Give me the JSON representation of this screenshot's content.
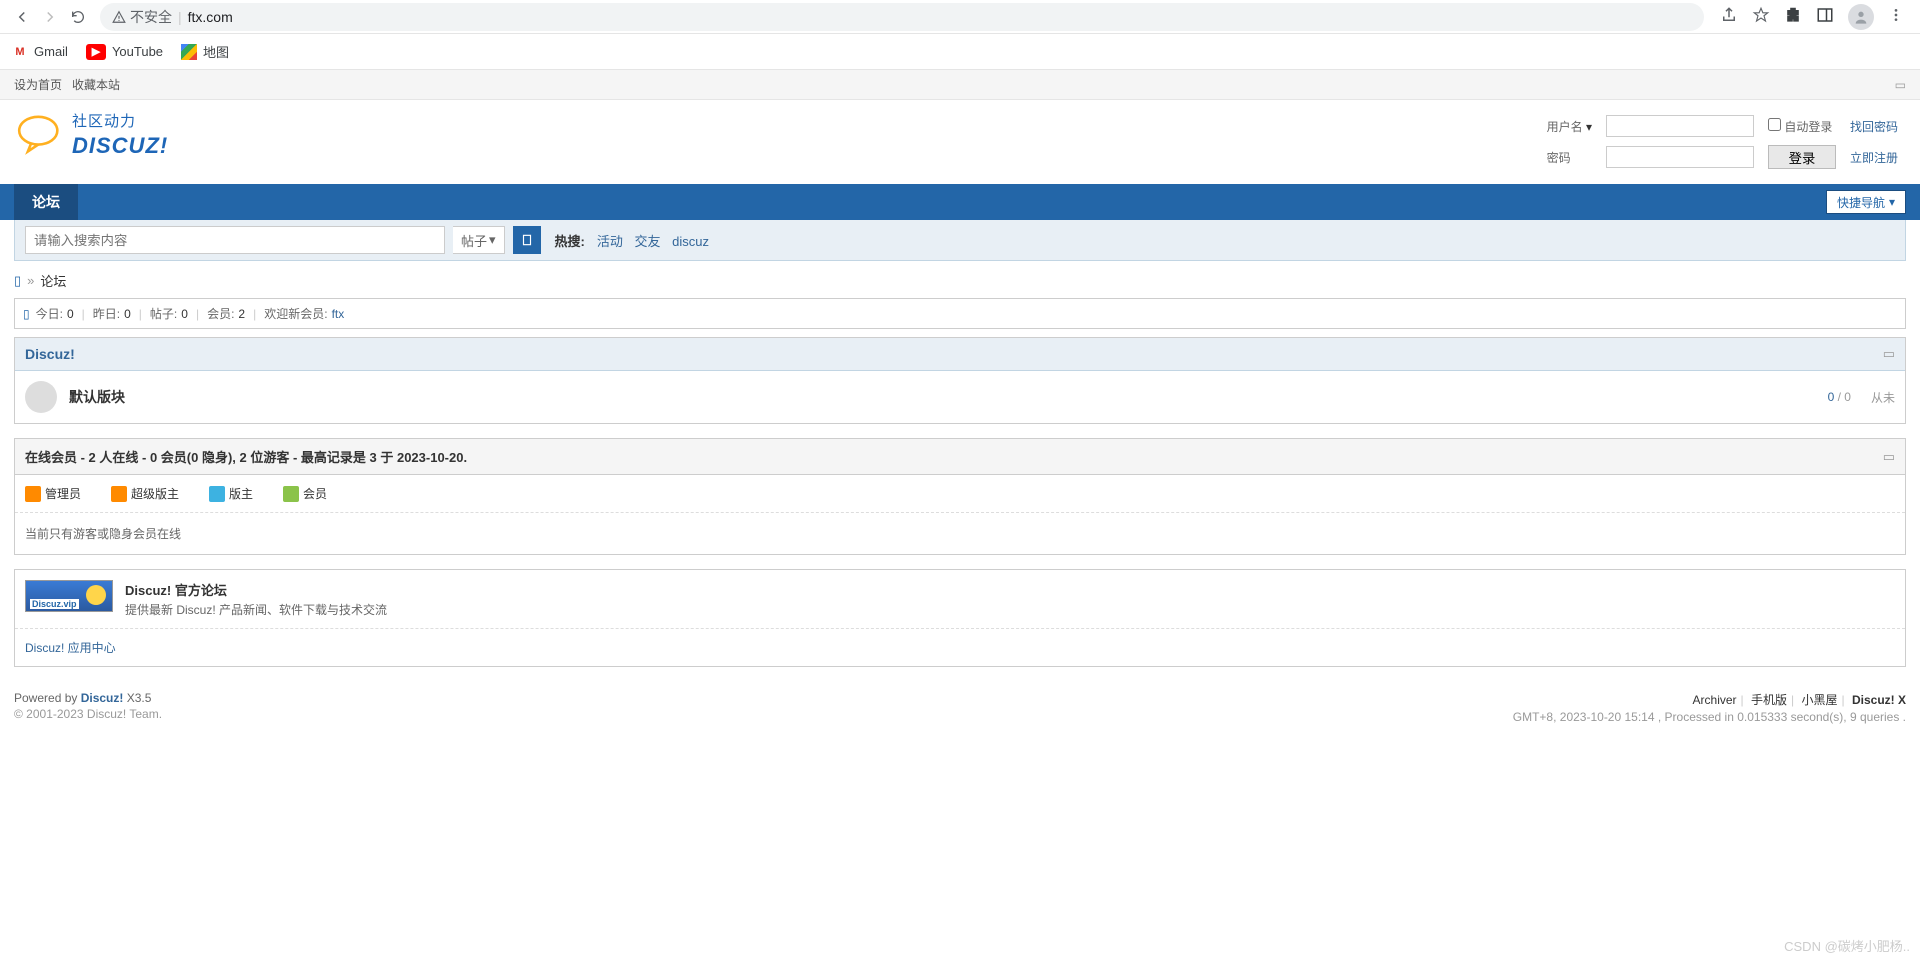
{
  "browser": {
    "insecure_label": "不安全",
    "url": "ftx.com",
    "bookmarks": [
      {
        "label": "Gmail",
        "icon": "gmail"
      },
      {
        "label": "YouTube",
        "icon": "youtube"
      },
      {
        "label": "地图",
        "icon": "map"
      }
    ]
  },
  "topbar": {
    "set_home": "设为首页",
    "favorite": "收藏本站"
  },
  "logo": {
    "cn": "社区动力",
    "en": "DISCUZ!"
  },
  "login": {
    "username_label": "用户名",
    "password_label": "密码",
    "auto_login": "自动登录",
    "find_password": "找回密码",
    "login_btn": "登录",
    "register": "立即注册"
  },
  "nav": {
    "forum_tab": "论坛",
    "quick_nav": "快捷导航"
  },
  "search": {
    "placeholder": "请输入搜索内容",
    "scope": "帖子",
    "hot_label": "热搜:",
    "hot_links": [
      "活动",
      "交友",
      "discuz"
    ]
  },
  "breadcrumb": {
    "current": "论坛"
  },
  "stats": {
    "today_label": "今日:",
    "today": "0",
    "yesterday_label": "昨日:",
    "yesterday": "0",
    "posts_label": "帖子:",
    "posts": "0",
    "members_label": "会员:",
    "members": "2",
    "welcome_label": "欢迎新会员:",
    "new_member": "ftx"
  },
  "category": {
    "name": "Discuz!",
    "forums": [
      {
        "name": "默认版块",
        "threads": "0",
        "posts": "0",
        "last": "从未"
      }
    ]
  },
  "online": {
    "header": "在线会员 - 2 人在线 - 0 会员(0 隐身), 2 位游客 - 最高记录是 3 于 2023-10-20.",
    "legend": [
      {
        "label": "管理员",
        "color": "#ff8a00"
      },
      {
        "label": "超级版主",
        "color": "#ff8a00"
      },
      {
        "label": "版主",
        "color": "#3db2e1"
      },
      {
        "label": "会员",
        "color": "#8bc34a"
      }
    ],
    "msg": "当前只有游客或隐身会员在线"
  },
  "links": {
    "featured": {
      "title": "Discuz! 官方论坛",
      "desc": "提供最新 Discuz! 产品新闻、软件下载与技术交流",
      "img_label": "Discuz.vip"
    },
    "simple": "Discuz! 应用中心"
  },
  "footer": {
    "powered_prefix": "Powered by ",
    "powered_brand": "Discuz!",
    "powered_ver": " X3.5",
    "copyright": "© 2001-2023 Discuz! Team.",
    "right_links": [
      "Archiver",
      "手机版",
      "小黑屋",
      "Discuz! X"
    ],
    "time": "GMT+8, 2023-10-20 15:14 , Processed in 0.015333 second(s), 9 queries ."
  },
  "watermark": "CSDN @碳烤小肥杨.."
}
